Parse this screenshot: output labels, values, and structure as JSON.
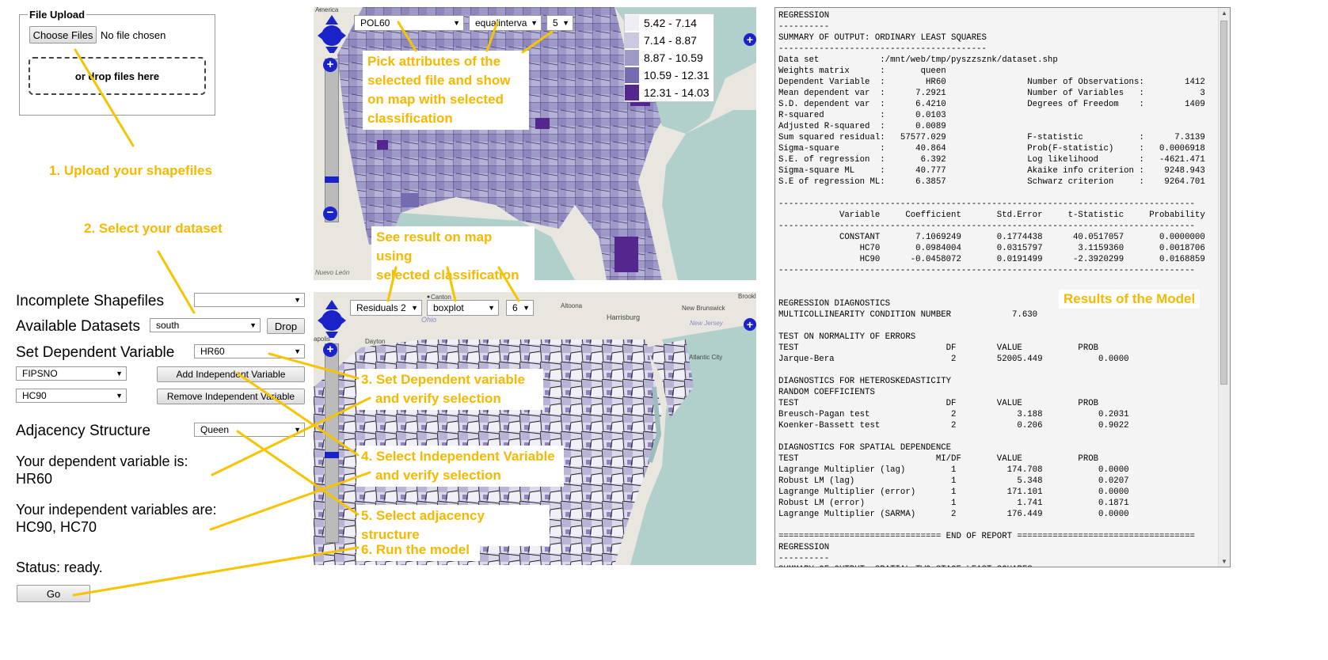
{
  "upload": {
    "legend": "File Upload",
    "choose_button": "Choose Files",
    "no_file": "No file chosen",
    "drop_text": "or drop files here"
  },
  "steps": {
    "s1": "1. Upload your shapefiles",
    "s2": "2. Select your dataset",
    "s3a": "3. Set Dependent variable",
    "s3b": "and verify selection",
    "s4a": "4. Select Independent Variable",
    "s4b": "and verify selection",
    "s5": "5. Select adjacency structure",
    "s6": "6. Run the model",
    "map_top_a": "Pick attributes of the",
    "map_top_b": "selected file and show",
    "map_top_c": "on map with selected",
    "map_top_d": "classification",
    "map_bottom_a": "See result on map using",
    "map_bottom_b": "selected classification",
    "results": "Results of the Model"
  },
  "form": {
    "incomplete_label": "Incomplete Shapefiles",
    "incomplete_value": "",
    "datasets_label": "Available Datasets",
    "datasets_value": "south",
    "drop_button": "Drop",
    "dependent_label": "Set Dependent Variable",
    "dependent_value": "HR60",
    "indep_select_1": "FIPSNO",
    "indep_select_2": "HC90",
    "add_button": "Add Independent Variable",
    "remove_button": "Remove Independent Variable",
    "adjacency_label": "Adjacency Structure",
    "adjacency_value": "Queen",
    "dep_info_label": "Your dependent variable is:",
    "dep_info_value": "HR60",
    "indep_info_label": "Your independent variables are:",
    "indep_info_value": "HC90, HC70",
    "status": "Status: ready.",
    "go_button": "Go"
  },
  "map_top": {
    "attribute": "POL60",
    "classification": "equalinterva",
    "classes": "5",
    "legend": [
      {
        "range": "5.42   - 7.14",
        "color": "#efedf5"
      },
      {
        "range": "7.14   - 8.87",
        "color": "#cbc9e2"
      },
      {
        "range": "8.87   - 10.59",
        "color": "#9e9ac8"
      },
      {
        "range": "10.59 - 12.31",
        "color": "#756bb1"
      },
      {
        "range": "12.31 - 14.03",
        "color": "#54278f"
      }
    ],
    "place_labels": {
      "america": "America",
      "nuevo_leon": "Nuevo León"
    }
  },
  "map_bottom": {
    "attribute": "Residuals 2",
    "classification": "boxplot",
    "classes": "6",
    "places": {
      "canton": "Canton",
      "altoona": "Altoona",
      "harrisburg": "Harrisburg",
      "new_brunswick": "New Brunswick",
      "brooklyn": "Brookl",
      "ohio": "Ohio",
      "new_jersey": "New Jersey",
      "dayton": "Dayton",
      "atlantic_city": "Atlantic City",
      "apolis": "apolis"
    }
  },
  "report_lines": [
    "REGRESSION",
    "----------",
    "SUMMARY OF OUTPUT: ORDINARY LEAST SQUARES",
    "-----------------------------------------",
    "Data set            :/mnt/web/tmp/pyszzsznk/dataset.shp",
    "Weights matrix      :       queen",
    "Dependent Variable  :        HR60                Number of Observations:        1412",
    "Mean dependent var  :      7.2921                Number of Variables   :           3",
    "S.D. dependent var  :      6.4210                Degrees of Freedom    :        1409",
    "R-squared           :      0.0103",
    "Adjusted R-squared  :      0.0089",
    "Sum squared residual:   57577.029                F-statistic           :      7.3139",
    "Sigma-square        :      40.864                Prob(F-statistic)     :   0.0006918",
    "S.E. of regression  :       6.392                Log likelihood        :   -4621.471",
    "Sigma-square ML     :      40.777                Akaike info criterion :    9248.943",
    "S.E of regression ML:      6.3857                Schwarz criterion     :    9264.701",
    "",
    "----------------------------------------------------------------------------------",
    "            Variable     Coefficient       Std.Error     t-Statistic     Probability",
    "----------------------------------------------------------------------------------",
    "            CONSTANT       7.1069249       0.1774438      40.0517057       0.0000000",
    "                HC70       0.0984004       0.0315797       3.1159360       0.0018706",
    "                HC90      -0.0458072       0.0191499      -2.3920299       0.0168859",
    "----------------------------------------------------------------------------------",
    "",
    "",
    "REGRESSION DIAGNOSTICS",
    "MULTICOLLINEARITY CONDITION NUMBER            7.630",
    "",
    "TEST ON NORMALITY OF ERRORS",
    "TEST                             DF        VALUE           PROB",
    "Jarque-Bera                       2        52005.449           0.0000",
    "",
    "DIAGNOSTICS FOR HETEROSKEDASTICITY",
    "RANDOM COEFFICIENTS",
    "TEST                             DF        VALUE           PROB",
    "Breusch-Pagan test                2            3.188           0.2031",
    "Koenker-Bassett test              2            0.206           0.9022",
    "",
    "DIAGNOSTICS FOR SPATIAL DEPENDENCE",
    "TEST                           MI/DF       VALUE           PROB",
    "Lagrange Multiplier (lag)         1          174.708           0.0000",
    "Robust LM (lag)                   1            5.348           0.0207",
    "Lagrange Multiplier (error)       1          171.101           0.0000",
    "Robust LM (error)                 1            1.741           0.1871",
    "Lagrange Multiplier (SARMA)       2          176.449           0.0000",
    "",
    "================================ END OF REPORT ===================================",
    "REGRESSION",
    "----------",
    "SUMMARY OF OUTPUT: SPATIAL TWO STAGE LEAST SQUARES"
  ]
}
